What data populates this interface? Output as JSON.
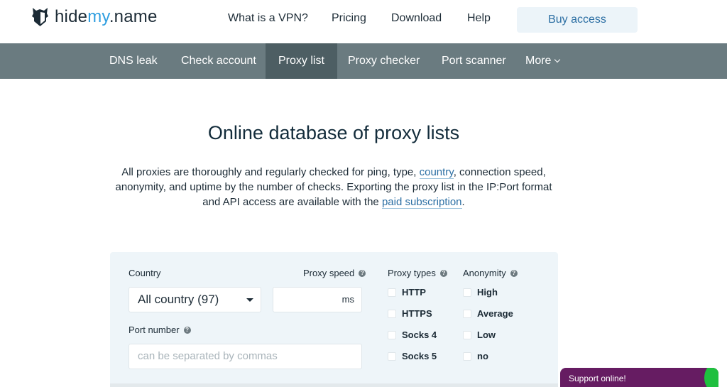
{
  "header": {
    "logo": {
      "prefix": "hide",
      "accent": "my",
      "suffix": ".name",
      "icon": "shield-fox-logo-icon"
    },
    "nav": [
      "What is a VPN?",
      "Pricing",
      "Download",
      "Help"
    ],
    "buy_button": "Buy access"
  },
  "subnav": {
    "items": [
      "DNS leak",
      "Check account",
      "Proxy list",
      "Proxy checker",
      "Port scanner",
      "More"
    ],
    "active": "Proxy list",
    "more_icon": "chevron-down-icon"
  },
  "main": {
    "title": "Online database of proxy lists",
    "desc": {
      "part1": "All proxies are thoroughly and regularly checked for ping, type, ",
      "link1": "country",
      "part2": ", connection speed, anonymity, and uptime by the number of checks. Exporting the proxy list in the IP:Port format and API access are available with the ",
      "link2": "paid subscription",
      "part3": "."
    }
  },
  "filter": {
    "country_label": "Country",
    "country_value": "All country (97)",
    "speed_label": "Proxy speed",
    "speed_unit": "ms",
    "speed_value": "",
    "port_label": "Port number",
    "port_placeholder": "can be separated by commas",
    "types_label": "Proxy types",
    "types": [
      "HTTP",
      "HTTPS",
      "Socks 4",
      "Socks 5"
    ],
    "anonymity_label": "Anonymity",
    "anonymity": [
      "High",
      "Average",
      "Low",
      "no"
    ],
    "help_glyph": "?"
  },
  "support": {
    "label": "Support online!"
  }
}
